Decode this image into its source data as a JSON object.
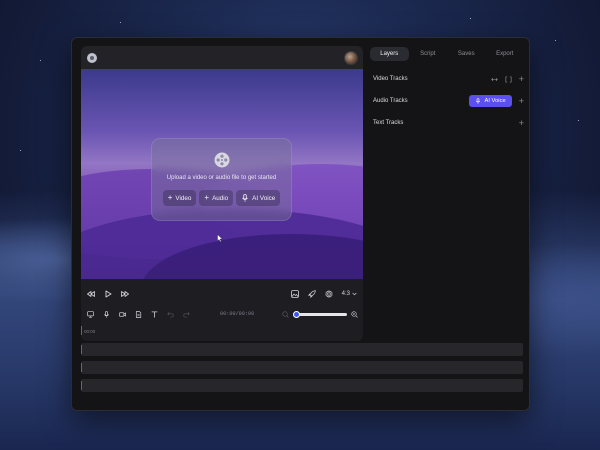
{
  "player": {
    "upload_prompt": "Upload a video or audio file to get started",
    "buttons": {
      "video": "Video",
      "audio": "Audio",
      "ai_voice": "AI Voice"
    },
    "aspect_ratio": "4:3"
  },
  "editor_toolbar": {
    "timecode": "00:00/00:00"
  },
  "zoom": {
    "level": 0.05
  },
  "timeline": {
    "ruler_start": "00:00",
    "track_count": 3
  },
  "side_panel": {
    "tabs": [
      "Layers",
      "Script",
      "Saves",
      "Export"
    ],
    "active_tab": "Layers",
    "sections": {
      "video": "Video Tracks",
      "audio": "Audio Tracks",
      "text": "Text Tracks"
    },
    "ai_voice_label": "AI Voice"
  },
  "colors": {
    "accent": "#5b4ff0",
    "playhead": "#e0334a",
    "slider": "#3d55ff"
  },
  "icons": [
    "logo-icon",
    "avatar",
    "film-reel-icon",
    "plus-icon",
    "mic-icon",
    "cursor-icon",
    "skip-back-icon",
    "play-icon",
    "skip-forward-icon",
    "image-icon",
    "rocket-icon",
    "gear-icon",
    "chevron-down-icon",
    "monitor-icon",
    "video-camera-icon",
    "document-icon",
    "text-icon",
    "undo-icon",
    "redo-icon",
    "zoom-out-icon",
    "zoom-in-icon",
    "swap-icon",
    "split-icon"
  ]
}
